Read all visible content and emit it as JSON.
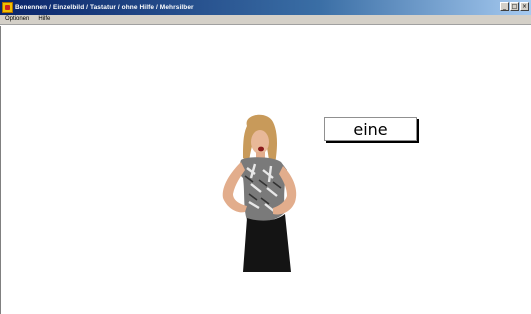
{
  "window": {
    "title": "Benennen / Einzelbild / Tastatur / ohne Hilfe / Mehrsilber",
    "caption_buttons": {
      "minimize": "_",
      "maximize": "□",
      "close": "×"
    }
  },
  "menu": {
    "items": [
      "Optionen",
      "Hilfe"
    ]
  },
  "exercise": {
    "word": "eine"
  },
  "icons": {
    "app": "app-logo-icon",
    "photo": "person-photo"
  }
}
